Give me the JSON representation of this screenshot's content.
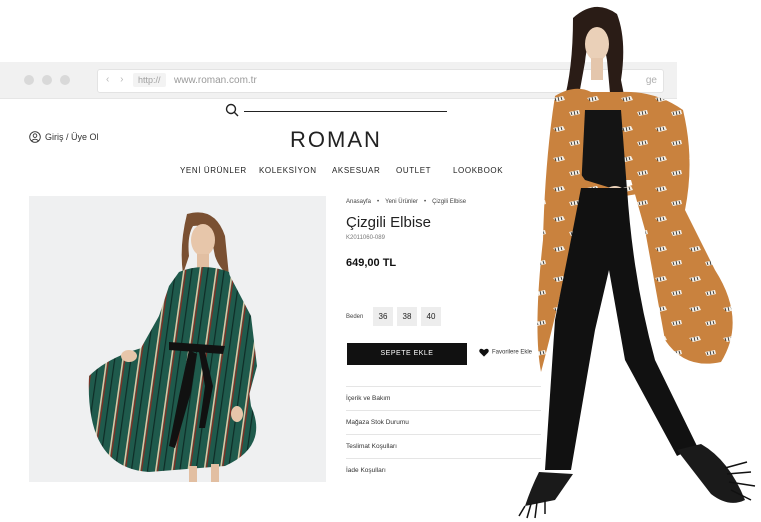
{
  "browser": {
    "nav_arrows": "‹ ›",
    "scheme": "http://",
    "url": "www.roman.com.tr",
    "url_tail": "ge"
  },
  "header": {
    "login": "Giriş / Üye Ol",
    "logo": "ROMAN",
    "menu": [
      "YENİ ÜRÜNLER",
      "KOLEKSİYON",
      "AKSESUAR",
      "OUTLET",
      "LOOKBOOK"
    ]
  },
  "product": {
    "breadcrumb": [
      "Anasayfa",
      "Yeni Ürünler",
      "Çizgili Elbise"
    ],
    "breadcrumb_sep": "•",
    "title": "Çizgili Elbise",
    "sku": "K2011060-089",
    "price": "649,00 TL",
    "size_label": "Beden",
    "sizes": [
      "36",
      "38",
      "40"
    ],
    "add_to_cart": "SEPETE EKLE",
    "favorite": "Favorilere Ekle",
    "accordion": [
      "İçerik ve Bakım",
      "Mağaza Stok Durumu",
      "Teslimat Koşulları",
      "İade Koşulları"
    ]
  },
  "colors": {
    "dress_green": "#1f5a4c",
    "cardigan_orange": "#c9823e",
    "button_black": "#111111"
  }
}
